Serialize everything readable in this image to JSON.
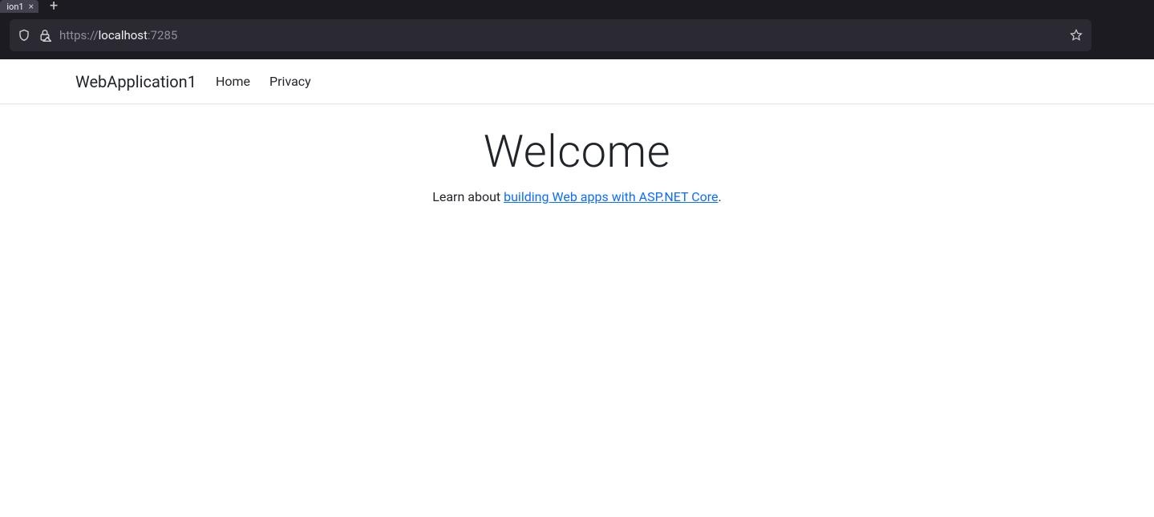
{
  "browser": {
    "tab": {
      "title_fragment": "ion1",
      "close_glyph": "×"
    },
    "new_tab_glyph": "+",
    "url": {
      "protocol": "https://",
      "host": "localhost",
      "port": ":7285"
    }
  },
  "navbar": {
    "brand": "WebApplication1",
    "links": [
      {
        "label": "Home"
      },
      {
        "label": "Privacy"
      }
    ]
  },
  "hero": {
    "title": "Welcome",
    "lead_prefix": "Learn about ",
    "link_text": "building Web apps with ASP.NET Core",
    "lead_suffix": "."
  }
}
